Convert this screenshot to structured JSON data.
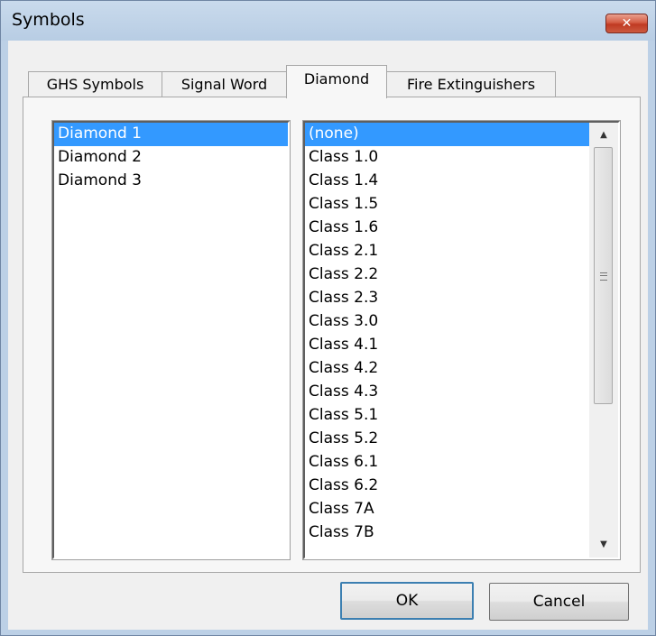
{
  "window": {
    "title": "Symbols",
    "close_glyph": "✕"
  },
  "tabs": [
    {
      "label": "GHS Symbols",
      "active": false
    },
    {
      "label": "Signal Word",
      "active": false
    },
    {
      "label": "Diamond",
      "active": true
    },
    {
      "label": "Fire Extinguishers",
      "active": false
    }
  ],
  "left_list": {
    "items": [
      "Diamond 1",
      "Diamond 2",
      "Diamond 3"
    ],
    "selected": "Diamond 1"
  },
  "right_list": {
    "items": [
      "(none)",
      "Class 1.0",
      "Class 1.4",
      "Class 1.5",
      "Class 1.6",
      "Class 2.1",
      "Class 2.2",
      "Class 2.3",
      "Class 3.0",
      "Class 4.1",
      "Class 4.2",
      "Class 4.3",
      "Class 5.1",
      "Class 5.2",
      "Class 6.1",
      "Class 6.2",
      "Class 7A",
      "Class 7B"
    ],
    "selected": "(none)"
  },
  "scrollbar": {
    "up_icon": "▲",
    "down_icon": "▼"
  },
  "buttons": {
    "ok": "OK",
    "cancel": "Cancel"
  }
}
